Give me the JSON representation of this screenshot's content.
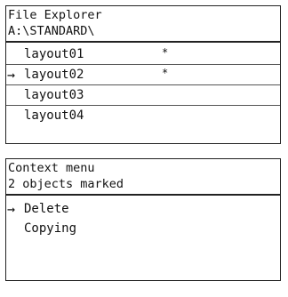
{
  "explorer": {
    "title": "File Explorer",
    "path": "A:\\STANDARD\\",
    "selection_marker": "→",
    "mark_symbol": "*",
    "files": [
      {
        "name": "layout01",
        "marked": true,
        "selected": false
      },
      {
        "name": "layout02",
        "marked": true,
        "selected": true
      },
      {
        "name": "layout03",
        "marked": false,
        "selected": false
      },
      {
        "name": "layout04",
        "marked": false,
        "selected": false
      }
    ]
  },
  "context_menu": {
    "title": "Context menu",
    "status": "2 objects marked",
    "selection_marker": "→",
    "items": [
      {
        "label": "Delete",
        "selected": true
      },
      {
        "label": "Copying",
        "selected": false
      }
    ]
  }
}
